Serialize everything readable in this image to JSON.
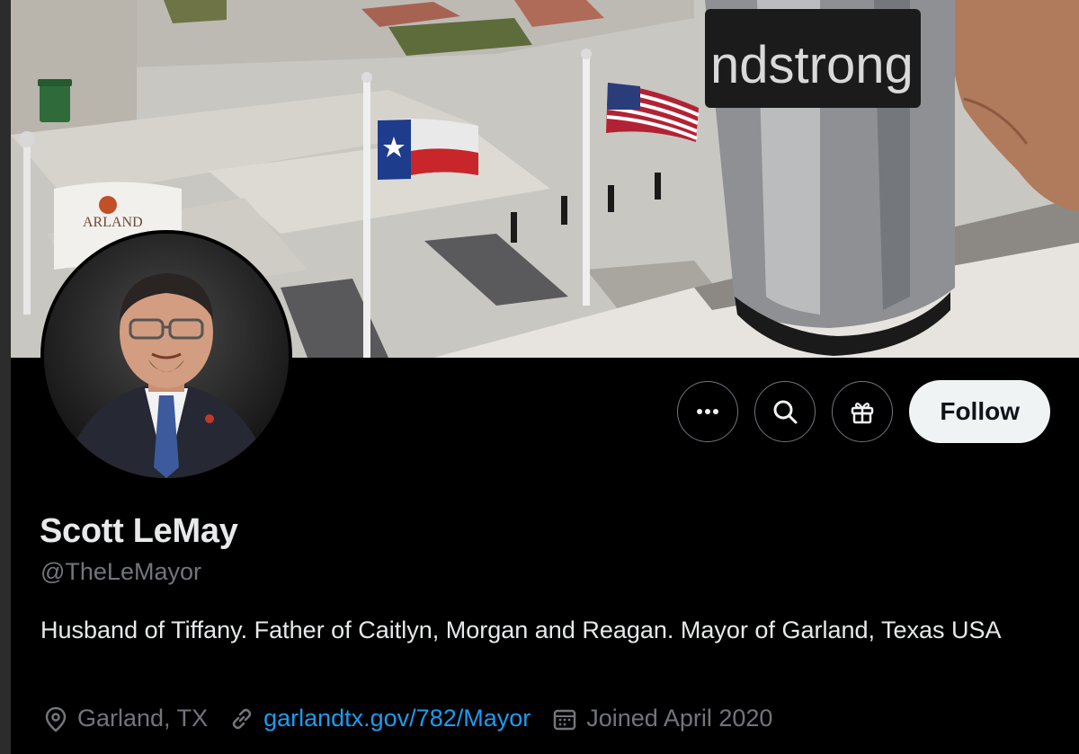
{
  "profile": {
    "name": "Scott LeMay",
    "handle": "@TheLeMayor",
    "bio": "Husband of Tiffany. Father of Caitlyn, Morgan and Reagan. Mayor of Garland, Texas USA",
    "location": "Garland, TX",
    "website": "garlandtx.gov/782/Mayor",
    "joined": "Joined April 2020"
  },
  "actions": {
    "more_icon": "more-horizontal-icon",
    "search_icon": "search-icon",
    "subscribe_icon": "gift-icon",
    "follow_label": "Follow"
  },
  "banner": {
    "sign_text": "ARLAND",
    "mug_text": "ndstrong"
  },
  "colors": {
    "background": "#000000",
    "text_primary": "#e7e9ea",
    "text_secondary": "#71767b",
    "link": "#1d9bf0",
    "follow_bg": "#eff3f4"
  }
}
